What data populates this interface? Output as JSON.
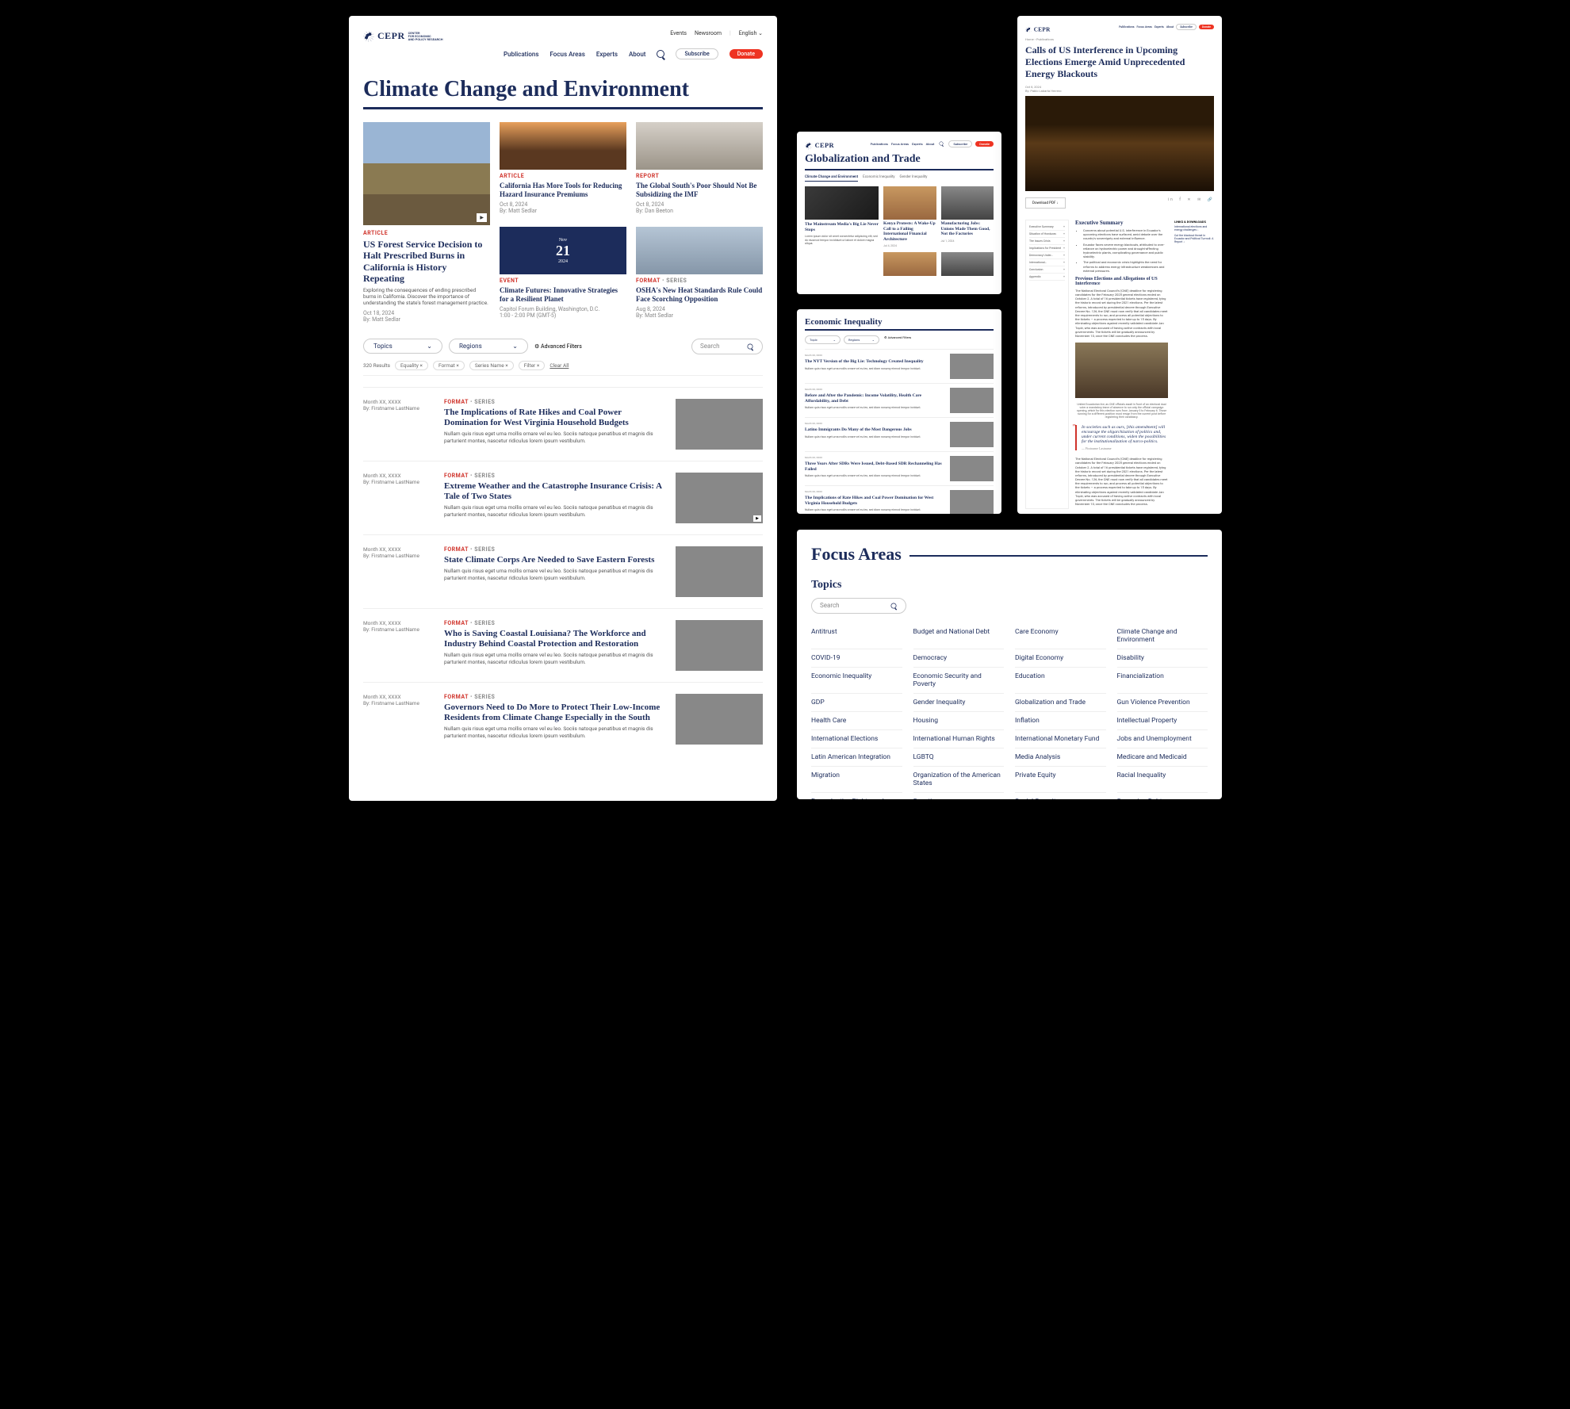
{
  "brand": {
    "name": "CEPR",
    "sub1": "CENTER",
    "sub2": "FOR ECONOMIC",
    "sub3": "AND POLICY RESEARCH"
  },
  "topnav": [
    "Events",
    "Newsroom",
    "English"
  ],
  "mainnav": [
    "Publications",
    "Focus Areas",
    "Experts",
    "About"
  ],
  "subscribe": "Subscribe",
  "donate": "Donate",
  "page1": {
    "title": "Climate Change and Environment",
    "lead": {
      "kicker": "ARTICLE",
      "title": "US Forest Service Decision to Halt Prescribed Burns in California is History Repeating",
      "desc": "Exploring the consequences of ending prescribed burns in California. Discover the importance of understanding the state's forest management practice.",
      "date": "Oct 18, 2024",
      "by": "By: Matt Sedlar"
    },
    "c2": {
      "kicker": "ARTICLE",
      "title": "California Has More Tools for Reducing Hazard Insurance Premiums",
      "date": "Oct 8, 2024",
      "by": "By: Matt Sedlar"
    },
    "c3": {
      "kicker": "REPORT",
      "title": "The Global South's Poor Should Not Be Subsidizing the IMF",
      "date": "Oct 8, 2024",
      "by": "By: Dan Beeton"
    },
    "c4": {
      "kicker": "EVENT",
      "mon": "Nov",
      "day": "21",
      "yr": "2024",
      "title": "Climate Futures: Innovative Strategies for a Resilient Planet",
      "loc": "Capitol Forum Building, Washington, D.C.",
      "time": "1:00 - 2:00 PM (GMT-5)"
    },
    "c5": {
      "kicker": "FORMAT",
      "series": "SERIES",
      "title": "OSHA's New Heat Standards Rule Could Face Scorching Opposition",
      "date": "Aug 8, 2024",
      "by": "By: Matt Sedlar"
    },
    "filters": {
      "topics": "Topics",
      "regions": "Regions",
      "adv": "Advanced Filters",
      "search": "Search"
    },
    "results": "320 Results",
    "chips": [
      "Equality ×",
      "Format ×",
      "Series Name ×",
      "Filter ×",
      "Clear All"
    ],
    "rows": [
      {
        "date": "Month XX, XXXX",
        "by": "By: Firstname LastName",
        "kicker": "FORMAT",
        "series": "SERIES",
        "title": "The Implications of Rate Hikes and Coal Power Domination for West Virginia Household Budgets",
        "desc": "Nullam quis risus eget urna mollis ornare vel eu leo. Sociis natoque penatibus et magnis dis parturient montes, nascetur ridiculus lorem ipsum vestibulum."
      },
      {
        "date": "Month XX, XXXX",
        "by": "By: Firstname LastName",
        "kicker": "FORMAT",
        "series": "SERIES",
        "title": "Extreme Weather and the Catastrophe Insurance Crisis: A Tale of Two States",
        "desc": "Nullam quis risus eget urna mollis ornare vel eu leo. Sociis natoque penatibus et magnis dis parturient montes, nascetur ridiculus lorem ipsum vestibulum."
      },
      {
        "date": "Month XX, XXXX",
        "by": "By: Firstname LastName",
        "kicker": "FORMAT",
        "series": "SERIES",
        "title": "State Climate Corps Are Needed to Save Eastern Forests",
        "desc": "Nullam quis risus eget urna mollis ornare vel eu leo. Sociis natoque penatibus et magnis dis parturient montes, nascetur ridiculus lorem ipsum vestibulum."
      },
      {
        "date": "Month XX, XXXX",
        "by": "By: Firstname LastName",
        "kicker": "FORMAT",
        "series": "SERIES",
        "title": "Who is Saving Coastal Louisiana? The Workforce and Industry Behind Coastal Protection and Restoration",
        "desc": "Nullam quis risus eget urna mollis ornare vel eu leo. Sociis natoque penatibus et magnis dis parturient montes, nascetur ridiculus lorem ipsum vestibulum."
      },
      {
        "date": "Month XX, XXXX",
        "by": "By: Firstname LastName",
        "kicker": "FORMAT",
        "series": "SERIES",
        "title": "Governors Need to Do More to Protect Their Low-Income Residents from Climate Change Especially in the South",
        "desc": "Nullam quis risus eget urna mollis ornare vel eu leo. Sociis natoque penatibus et magnis dis parturient montes, nascetur ridiculus lorem ipsum vestibulum."
      }
    ]
  },
  "page2": {
    "title": "Globalization and Trade",
    "tabs": [
      "Climate Change and Environment",
      "Economic Inequality",
      "Gender Inequality"
    ],
    "lead": {
      "title": "The Mainstream Media's Big Lie Never Stops",
      "desc": "Lorem ipsum dolor sit amet consectetur adipiscing elit, sed do eiusmod tempor incididunt ut labore et dolore magna aliqua."
    },
    "side": [
      {
        "title": "Kenya Protests: A Wake-Up Call to a Failing International Financial Architecture",
        "date": "Jul 4, 2024"
      },
      {
        "title": "Manufacturing Jobs: Unions Made Them Good, Not the Factories",
        "date": "Jul 1, 2024"
      }
    ]
  },
  "page3": {
    "title": "Economic Inequality",
    "rows": [
      {
        "title": "The NYT Version of the Big Lie: Technology Created Inequality"
      },
      {
        "title": "Before and After the Pandemic: Income Volatility, Health Care Affordability, and Debt"
      },
      {
        "title": "Latino Immigrants Do Many of the Most Dangerous Jobs"
      },
      {
        "title": "Three Years After SDRs Were Issued, Debt-Based SDR Rechanneling Has Failed"
      },
      {
        "title": "The Implications of Rate Hikes and Coal Power Domination for West Virginia Household Budgets"
      }
    ]
  },
  "page4": {
    "crumb": "Home › Publications",
    "title": "Calls of US Interference in Upcoming Elections Emerge Amid Unprecedented Energy Blackouts",
    "date": "Oct 8, 2024",
    "by": "By: Pablo Labarta Herrero",
    "download": "Download PDF ↓",
    "toc": [
      "Executive Summary",
      "Situation of Honduras",
      "The Issues Crisis",
      "Implications for President",
      "Democracy Under…",
      "International…",
      "Conclusion",
      "Appendix"
    ],
    "exec": "Executive Summary",
    "bullets": [
      "Concerns about potential U.S. interference in Ecuador's upcoming elections have surfaced, amid debate over the country's sovereignty and external influence.",
      "Ecuador faces severe energy blackouts, attributed to over-reliance on hydroelectric power and drought-affecting hydroelectric plants, complicating governance and public stability.",
      "The political and economic crisis highlights the need for reforms to address energy infrastructure weaknesses and external pressures."
    ],
    "sub": "Previous Elections and Allegations of US Interference",
    "body": "The National Electoral Council's (CNE) deadline for registering candidates for the February 2025 general elections ended on October 2. A total of 16 presidential tickets have registered, tying the historic record set during the 2021 elections. Per the latest reforms, introduced by presidential decree through Executive Decree No. 126, the CNE must now verify that all candidates meet the requirements to run, and process all potential objections to the tickets — a process expected to take up to 15 days. By eliminating objections against recently validated candidate Jan Topić, who was accused of having active contracts with local governments. The tickets will be gradually announced by November 10, once the CNE concludes the process.",
    "caption": "United Ecuadorian live, as CNE officials await in front of an electoral dual voter a mandatory leave of absence to run only the official campaign opening, which for this election runs from January 5 to February 6. Those running for a different position must resign from the current post before registering their candidacy.",
    "pull": "In societies such as ours, [this amendment] will encourage the oligarchization of politics and, under current conditions, widen the possibilities for the institutionalization of narco-politics.",
    "pullby": "— Firstname Lastname",
    "linksH": "LINKS & DOWNLOADS",
    "links": [
      "International elections and energy challenges ↓",
      "Cut the blackout threat in Ecuador and Political Turmoil: A Report ↓"
    ]
  },
  "page5": {
    "title": "Focus Areas",
    "sub": "Topics",
    "search": "Search",
    "topics": [
      "Antitrust",
      "Budget and National Debt",
      "Care Economy",
      "Climate Change and Environment",
      "COVID-19",
      "Democracy",
      "Digital Economy",
      "Disability",
      "Economic Inequality",
      "Economic Security and Poverty",
      "Education",
      "Financialization",
      "GDP",
      "Gender Inequality",
      "Globalization and Trade",
      "Gun Violence Prevention",
      "Health Care",
      "Housing",
      "Inflation",
      "Intellectual Property",
      "International Elections",
      "International Human Rights",
      "International Monetary Fund",
      "Jobs and Unemployment",
      "Latin American Integration",
      "LGBTQ",
      "Media Analysis",
      "Medicare and Medicaid",
      "Migration",
      "Organization of the American States",
      "Private Equity",
      "Racial Inequality",
      "Reproductive Rights and Family",
      "Sanctions",
      "Social Security",
      "Sovereign Debt"
    ]
  }
}
